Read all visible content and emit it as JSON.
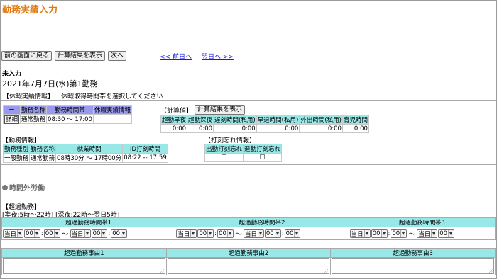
{
  "page": {
    "title": "勤務実績入力",
    "status": "未入力",
    "date_heading": "2021年7月7日(水)第1勤務"
  },
  "toolbar": {
    "back_label": "前の画面に戻る",
    "calc_label": "計算結果を表示",
    "next_label": "次へ"
  },
  "nav": {
    "prev_day": "<< 前日へ",
    "next_day": "翌日へ >>"
  },
  "leave": {
    "section_label": "【休暇実績情報】",
    "instruction": "休暇取得時間帯を選択してください",
    "headers": [
      "ー",
      "勤務名称",
      "勤務時間帯",
      "休暇実績情報"
    ],
    "row": {
      "detail": "詳細",
      "name": "通常勤務",
      "time": "08:30 〜 17:00",
      "info": ""
    }
  },
  "calc": {
    "label": "【計算値】",
    "button": "計算結果を表示",
    "headers": [
      "超勤早夜",
      "超勤深夜",
      "遅刻時間(私用)",
      "早退時間(私用)",
      "外出時間(私用)",
      "育児時間"
    ],
    "values": [
      "0:00",
      "0:00",
      "0:00",
      "0:00",
      "0:00",
      "0:00"
    ]
  },
  "work": {
    "label": "【勤務情報】",
    "headers": [
      "勤務種別",
      "勤務名称",
      "就業時間",
      "ID打刻時間"
    ],
    "row": {
      "type": "一般勤務",
      "name": "通常勤務",
      "hours": "08時30分 〜 17時00分",
      "id_time": "08:22 -- 17:59"
    }
  },
  "stamp": {
    "label": "【打刻忘れ情報】",
    "headers": [
      "出勤打刻忘れ",
      "退勤打刻忘れ"
    ]
  },
  "overtime": {
    "section_title": "時間外労働",
    "label": "【超過勤務】",
    "note": "[準夜:5時〜22時] [深夜:22時〜翌日5時]",
    "band_headers": [
      "超過勤務時間帯1",
      "超過勤務時間帯2",
      "超過勤務時間帯3"
    ],
    "day_value": "当日",
    "hour_value": "00",
    "minute_value": "00",
    "tilde": "〜",
    "reason_headers": [
      "超過勤務事由1",
      "超過勤務事由2",
      "超過勤務事由3"
    ]
  },
  "colors": {
    "title": "#e07a10",
    "header_blue": "#9999ee",
    "header_cyan": "#99e8e8",
    "link": "#1a1ae0"
  }
}
